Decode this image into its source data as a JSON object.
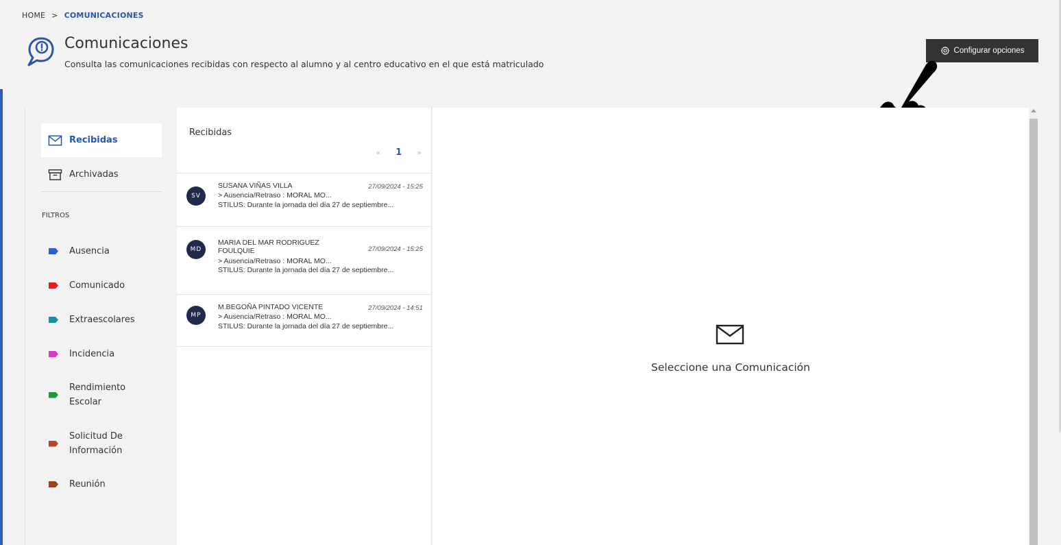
{
  "breadcrumb": {
    "home": "HOME",
    "separator": ">",
    "current": "COMUNICACIONES"
  },
  "header": {
    "title": "Comunicaciones",
    "subtitle": "Consulta las comunicaciones recibidas con respecto al alumno y al centro educativo en el que está matriculado",
    "icon": "chat-bubble-alert-icon",
    "config_button": "Configurar opciones",
    "config_icon": "gear-icon"
  },
  "sidebar": {
    "items": [
      {
        "label": "Recibidas",
        "icon": "envelope-icon",
        "active": true
      },
      {
        "label": "Archivadas",
        "icon": "archive-box-icon",
        "active": false
      }
    ],
    "filters_label": "FILTROS",
    "filters": [
      {
        "label": "Ausencia",
        "color": "#2b5fd0"
      },
      {
        "label": "Comunicado",
        "color": "#e02020"
      },
      {
        "label": "Extraescolares",
        "color": "#1f8fa0"
      },
      {
        "label": "Incidencia",
        "color": "#d43ac4"
      },
      {
        "label": "Rendimiento Escolar",
        "color": "#1e9a3c"
      },
      {
        "label": "Solicitud De Información",
        "color": "#b5462a"
      },
      {
        "label": "Reunión",
        "color": "#a0401c"
      }
    ]
  },
  "list": {
    "title": "Recibidas",
    "pager": {
      "prev": "«",
      "page": "1",
      "next": "»"
    },
    "messages": [
      {
        "initials": "SV",
        "sender": "SUSANA VIÑAS VILLA",
        "date": "27/09/2024 - 15:25",
        "subject": "> Ausencia/Retraso : MORAL MO...",
        "preview": "STILUS: Durante la jornada del día 27 de septiembre..."
      },
      {
        "initials": "MD",
        "sender": "MARIA DEL MAR RODRIGUEZ FOULQUIE",
        "date": "27/09/2024 - 15:25",
        "subject": "> Ausencia/Retraso : MORAL MO...",
        "preview": "STILUS: Durante la jornada del día 27 de septiembre..."
      },
      {
        "initials": "MP",
        "sender": "M.BEGOÑA PINTADO VICENTE",
        "date": "27/09/2024 - 14:51",
        "subject": "> Ausencia/Retraso : MORAL MO...",
        "preview": "STILUS: Durante la jornada del día 27 de septiembre..."
      }
    ]
  },
  "detail": {
    "empty_icon": "envelope-icon",
    "empty_text": "Seleccione una Comunicación"
  },
  "overlay": {
    "pointer_icon": "pointing-hand-icon"
  }
}
